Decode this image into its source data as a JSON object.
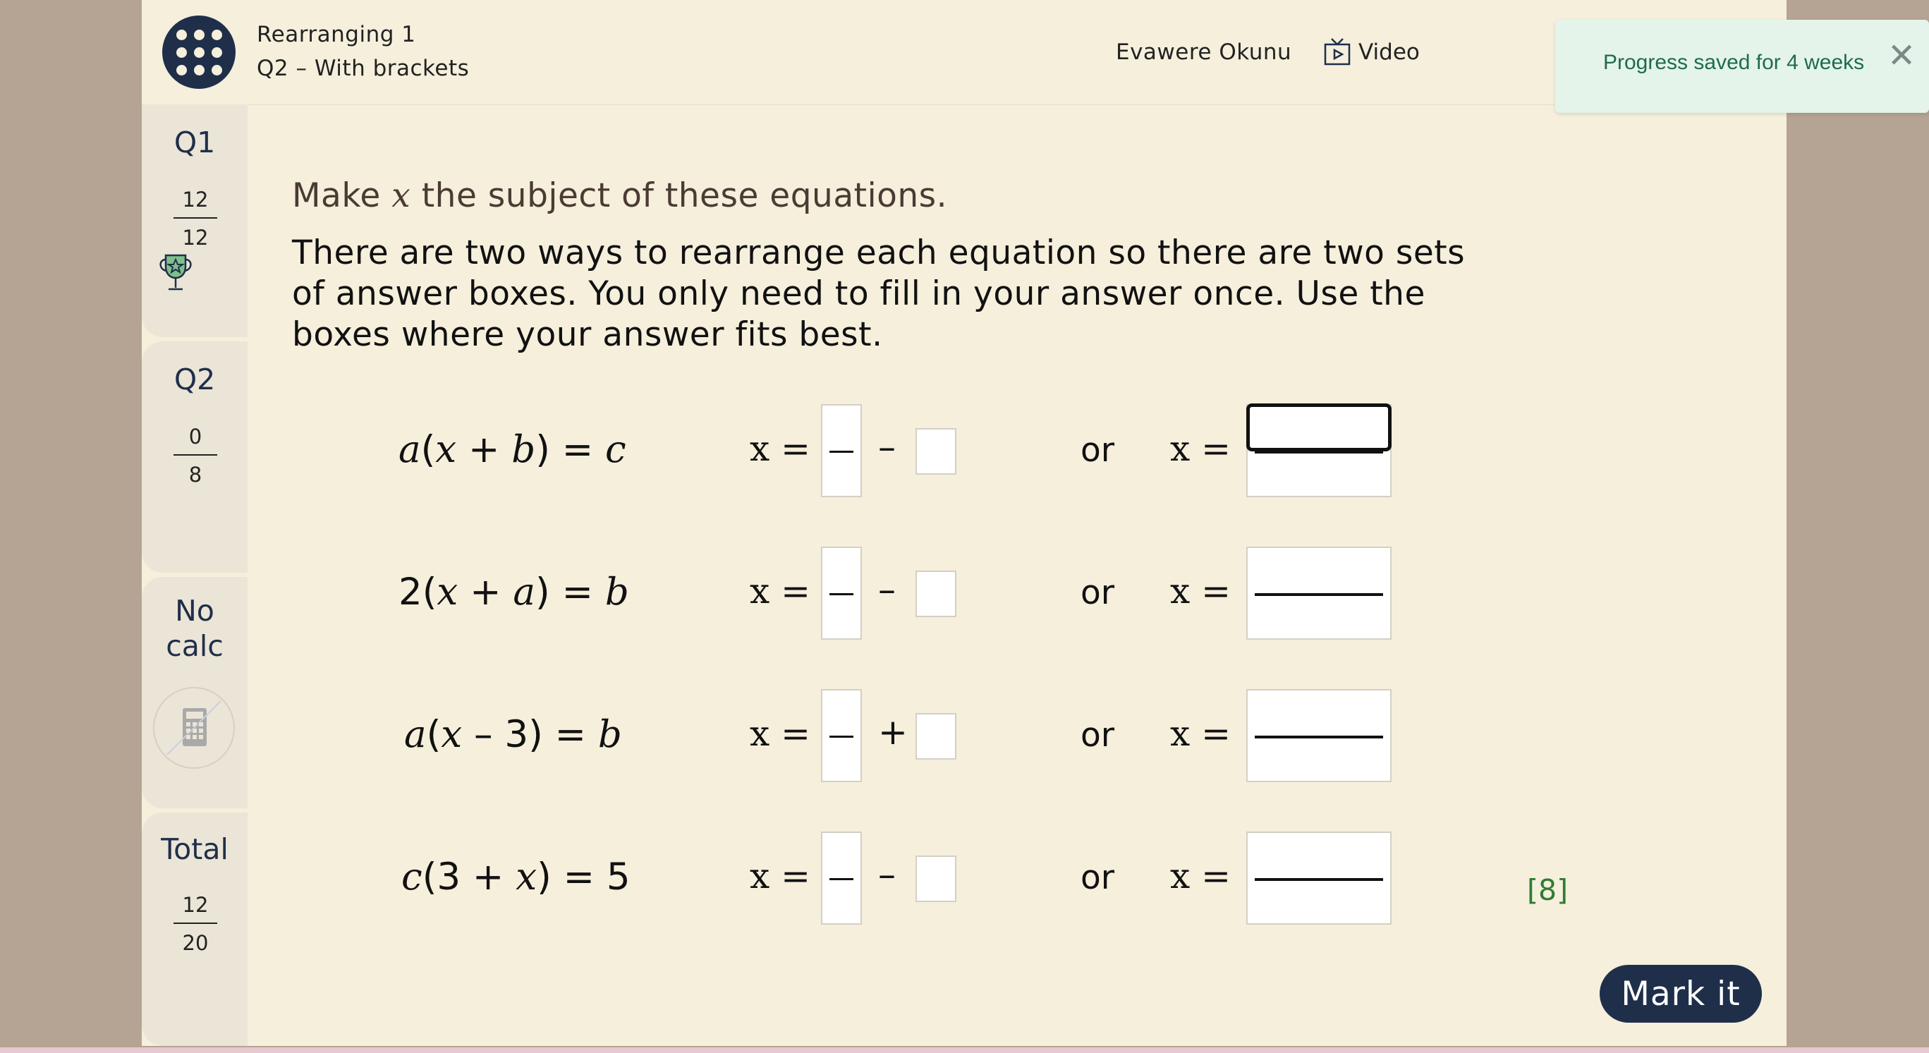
{
  "header": {
    "lesson_title": "Rearranging 1",
    "question_title": "Q2 – With brackets",
    "user_name": "Evawere Okunu",
    "video_label": "Video"
  },
  "toast": {
    "message": "Progress saved for 4 weeks",
    "close_symbol": "✕"
  },
  "sidebar": {
    "q1": {
      "label": "Q1",
      "score": "12",
      "out_of": "12",
      "icon": "trophy-icon"
    },
    "q2": {
      "label": "Q2",
      "score": "0",
      "out_of": "8"
    },
    "calculator": {
      "line1": "No",
      "line2": "calc",
      "icon": "no-calculator-icon"
    },
    "total": {
      "label": "Total",
      "score": "12",
      "out_of": "20"
    }
  },
  "question": {
    "instruction_pre": "Make ",
    "instruction_var": "x",
    "instruction_post": " the subject of these equations.",
    "explanation": "There are two ways to rearrange each equation so there are two sets of answer boxes. You only need to fill in your answer once. Use the boxes where your answer fits best.",
    "x_equals": "x =",
    "or_label": "or",
    "equations": [
      {
        "parts": [
          "a",
          "(",
          "x",
          " + ",
          "b",
          ")",
          " = ",
          "c"
        ],
        "sign": "–"
      },
      {
        "parts": [
          "2",
          "(",
          "x",
          " + ",
          "a",
          ")",
          " = ",
          "b"
        ],
        "sign": "–"
      },
      {
        "parts": [
          "a",
          "(",
          "x",
          " – 3",
          ")",
          " = ",
          "b",
          ""
        ],
        "sign": "+"
      },
      {
        "parts": [
          "c",
          "(3 + ",
          "x",
          ")",
          " = ",
          "5",
          "",
          ""
        ],
        "sign": "–"
      }
    ],
    "marks": "[8]"
  },
  "mark_button_label": "Mark it",
  "colors": {
    "navy": "#1f2f4a",
    "page_bg": "#f5efdc",
    "toast_bg": "#e4f4ea",
    "toast_text": "#1f6b4f",
    "marks_green": "#2e7d32"
  }
}
